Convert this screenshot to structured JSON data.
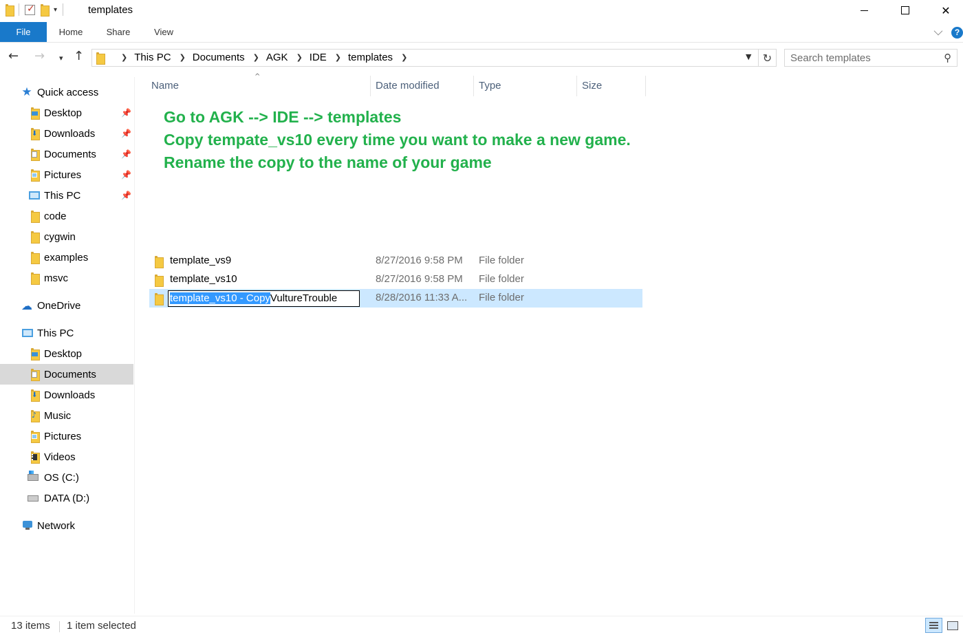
{
  "window": {
    "title": "templates"
  },
  "ribbon": {
    "tabs": [
      "File",
      "Home",
      "Share",
      "View"
    ],
    "help": "?"
  },
  "address": {
    "breadcrumbs": [
      "This PC",
      "Documents",
      "AGK",
      "IDE",
      "templates"
    ],
    "search_placeholder": "Search templates"
  },
  "sidebar": {
    "quick_access": "Quick access",
    "quick_items": [
      {
        "label": "Desktop",
        "icon": "desktop-folder-icon",
        "pinned": true
      },
      {
        "label": "Downloads",
        "icon": "downloads-folder-icon",
        "pinned": true
      },
      {
        "label": "Documents",
        "icon": "documents-folder-icon",
        "pinned": true
      },
      {
        "label": "Pictures",
        "icon": "pictures-folder-icon",
        "pinned": true
      },
      {
        "label": "This PC",
        "icon": "computer-icon",
        "pinned": true
      },
      {
        "label": "code",
        "icon": "folder-icon",
        "pinned": false
      },
      {
        "label": "cygwin",
        "icon": "folder-icon",
        "pinned": false
      },
      {
        "label": "examples",
        "icon": "folder-icon",
        "pinned": false
      },
      {
        "label": "msvc",
        "icon": "folder-icon",
        "pinned": false
      }
    ],
    "onedrive": "OneDrive",
    "this_pc": "This PC",
    "pc_items": [
      {
        "label": "Desktop",
        "icon": "desktop-folder-icon"
      },
      {
        "label": "Documents",
        "icon": "documents-folder-icon",
        "selected": true
      },
      {
        "label": "Downloads",
        "icon": "downloads-folder-icon"
      },
      {
        "label": "Music",
        "icon": "music-folder-icon"
      },
      {
        "label": "Pictures",
        "icon": "pictures-folder-icon"
      },
      {
        "label": "Videos",
        "icon": "videos-folder-icon"
      },
      {
        "label": "OS (C:)",
        "icon": "windows-drive-icon"
      },
      {
        "label": "DATA (D:)",
        "icon": "drive-icon"
      }
    ],
    "network": "Network"
  },
  "columns": {
    "name": "Name",
    "date": "Date modified",
    "type": "Type",
    "size": "Size"
  },
  "annotation": {
    "line1": "Go to AGK --> IDE --> templates",
    "line2": "Copy tempate_vs10 every time you want to make a new game.",
    "line3": "Rename the copy to the name of your game",
    "color": "#22b14c"
  },
  "files": [
    {
      "name": "template_vs9",
      "date": "8/27/2016 9:58 PM",
      "type": "File folder"
    },
    {
      "name": "template_vs10",
      "date": "8/27/2016 9:58 PM",
      "type": "File folder"
    },
    {
      "name": "template_vs10 - Copy",
      "date": "8/28/2016 11:33 A...",
      "type": "File folder",
      "selected": true,
      "rename": {
        "selected_text": "template_vs10 - Copy",
        "typed_text": "VultureTrouble"
      }
    }
  ],
  "status": {
    "item_count": "13 items",
    "selection": "1 item selected"
  },
  "colors": {
    "accent": "#1979ca",
    "selection": "#cce8ff",
    "sidebar_selected": "#d9d9d9"
  }
}
